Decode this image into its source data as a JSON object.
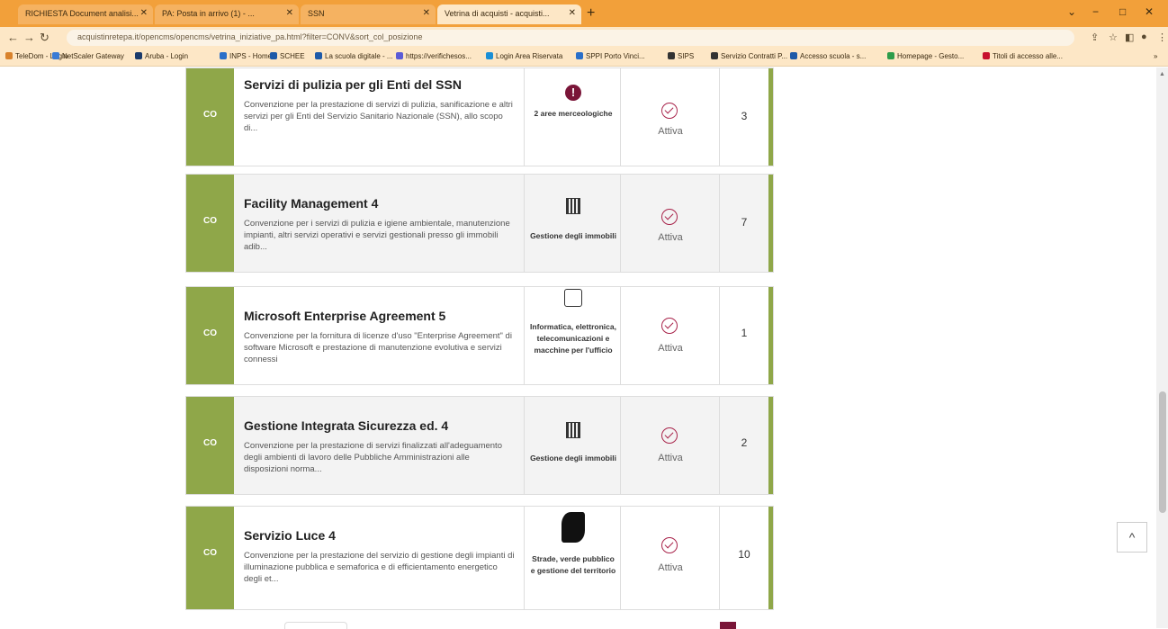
{
  "browser": {
    "tabs": [
      {
        "label": "RICHIESTA Document analisi..."
      },
      {
        "label": "PA: Posta in arrivo (1) - ..."
      },
      {
        "label": "SSN"
      },
      {
        "label": "Vetrina di acquisti - acquisti..."
      }
    ],
    "url": "acquistinretepa.it/opencms/opencms/vetrina_iniziative_pa.html?filter=CONV&sort_col_posizione",
    "bookmarks": [
      {
        "label": "TeleDom - Login",
        "color": "#d9822b"
      },
      {
        "label": "NetScaler Gateway",
        "color": "#3a7bd5"
      },
      {
        "label": "Aruba - Login",
        "color": "#1a3a6b"
      },
      {
        "label": "INPS - Home",
        "color": "#2a6fc9"
      },
      {
        "label": "SCHEE",
        "color": "#1e5aa8"
      },
      {
        "label": "La scuola digitale - ...",
        "color": "#1e5aa8"
      },
      {
        "label": "https://verifichesos...",
        "color": "#5b5bd6"
      },
      {
        "label": "Login Area Riservata",
        "color": "#1a8fd6"
      },
      {
        "label": "SPPI Porto Vinci...",
        "color": "#2a6fc9"
      },
      {
        "label": "SIPS",
        "color": "#333"
      },
      {
        "label": "Servizio Contratti P...",
        "color": "#333"
      },
      {
        "label": "Accesso scuola - s...",
        "color": "#1e5aa8"
      },
      {
        "label": "Homepage - Gesto...",
        "color": "#2d9c4a"
      },
      {
        "label": "Titoli di accesso alle...",
        "color": "#c8102e"
      }
    ]
  },
  "rows": [
    {
      "badge": "CO",
      "title": "Servizi di pulizia per gli Enti del SSN",
      "desc": "Convenzione per la prestazione di servizi di pulizia, sanificazione e altri servizi per gli Enti del Servizio Sanitario Nazionale (SSN), allo scopo di...",
      "category": "2 aree merceologiche",
      "status": "Attiva",
      "count": "3"
    },
    {
      "badge": "CO",
      "title": "Facility Management 4",
      "desc": "Convenzione per i servizi di pulizia e igiene ambientale, manutenzione impianti, altri servizi operativi e servizi gestionali presso gli immobili adib...",
      "category": "Gestione degli immobili",
      "status": "Attiva",
      "count": "7"
    },
    {
      "badge": "CO",
      "title": "Microsoft Enterprise Agreement 5",
      "desc": "Convenzione per la fornitura di licenze d'uso \"Enterprise Agreement\" di software Microsoft e prestazione di manutenzione evolutiva e servizi connessi",
      "category": "Informatica, elettronica, telecomunicazioni e macchine per l'ufficio",
      "status": "Attiva",
      "count": "1"
    },
    {
      "badge": "CO",
      "title": "Gestione Integrata Sicurezza ed. 4",
      "desc": "Convenzione per la prestazione di servizi finalizzati all'adeguamento degli ambienti di lavoro delle Pubbliche Amministrazioni alle disposizioni norma...",
      "category": "Gestione degli immobili",
      "status": "Attiva",
      "count": "2"
    },
    {
      "badge": "CO",
      "title": "Servizio Luce 4",
      "desc": "Convenzione per la prestazione del servizio di gestione degli impianti di illuminazione pubblica e semaforica e di efficientamento energetico degli et...",
      "category": "Strade, verde pubblico e gestione del territorio",
      "status": "Attiva",
      "count": "10"
    }
  ],
  "scroll_top_label": "^"
}
